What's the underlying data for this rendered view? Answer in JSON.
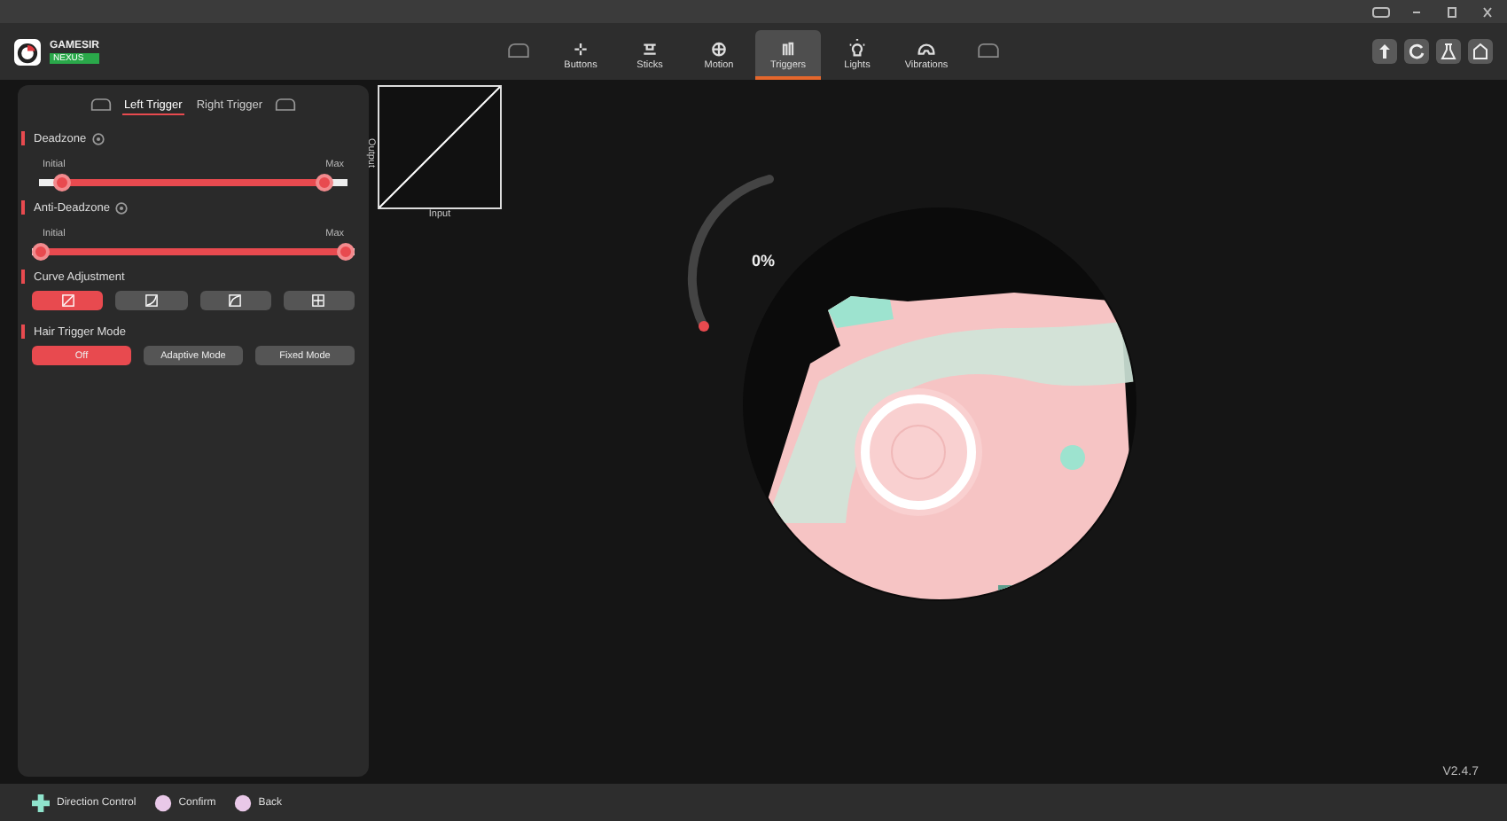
{
  "app": {
    "brand": "GAMESIR",
    "badge": "NEXUS"
  },
  "nav": [
    {
      "label": "Buttons",
      "selected": false
    },
    {
      "label": "Sticks",
      "selected": false
    },
    {
      "label": "Motion",
      "selected": false
    },
    {
      "label": "Triggers",
      "selected": true
    },
    {
      "label": "Lights",
      "selected": false
    },
    {
      "label": "Vibrations",
      "selected": false
    }
  ],
  "trigger_tabs": [
    {
      "label": "Left Trigger",
      "selected": true
    },
    {
      "label": "Right Trigger",
      "selected": false
    }
  ],
  "deadzone": {
    "title": "Deadzone",
    "min_label": "Initial",
    "max_label": "Max",
    "thumbs": [
      {
        "level": 0.05
      },
      {
        "level": 0.95
      }
    ]
  },
  "anti_deadzone": {
    "title": "Anti-Deadzone",
    "min_label": "Initial",
    "max_label": "Max",
    "thumbs": [
      {
        "level": 0
      },
      {
        "level": 1
      }
    ]
  },
  "curve_adjustment": {
    "title": "Curve Adjustment",
    "options": [
      {
        "selected": true
      },
      {
        "selected": false
      },
      {
        "selected": false
      },
      {
        "selected": false
      }
    ]
  },
  "hair_trigger_mode": {
    "title": "Hair Trigger Mode",
    "options": [
      {
        "label": "Off",
        "selected": true
      },
      {
        "label": "Adaptive Mode",
        "selected": false
      },
      {
        "label": "Fixed Mode",
        "selected": false
      }
    ]
  },
  "curve_chart": {
    "ylabel": "Output",
    "xlabel": "Input"
  },
  "gauge": {
    "reading": "0%",
    "level": 0
  },
  "version": "V2.4.7",
  "footer": [
    {
      "kind": "dpad",
      "label": "Direction Control"
    },
    {
      "kind": "button",
      "label": "Confirm"
    },
    {
      "kind": "button",
      "label": "Back"
    }
  ]
}
